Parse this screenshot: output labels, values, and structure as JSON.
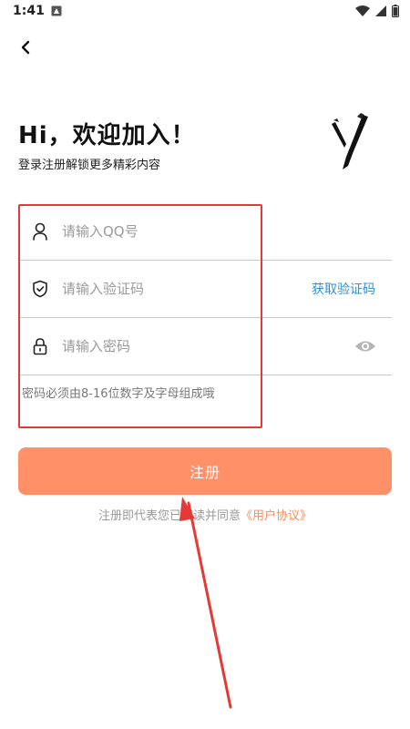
{
  "status_bar": {
    "time": "1:41",
    "icons": [
      "notification-icon",
      "wifi-icon",
      "signal-icon",
      "battery-icon"
    ]
  },
  "header": {
    "back_icon": "chevron-left-icon"
  },
  "hero": {
    "title": "Hi，欢迎加入！",
    "subtitle": "登录注册解锁更多精彩内容",
    "logo_icon": "brand-y-logo"
  },
  "form": {
    "qq": {
      "placeholder": "请输入QQ号",
      "value": "",
      "icon": "user-icon"
    },
    "code": {
      "placeholder": "请输入验证码",
      "value": "",
      "icon": "shield-icon",
      "action_label": "获取验证码"
    },
    "password": {
      "placeholder": "请输入密码",
      "value": "",
      "icon": "lock-icon",
      "toggle_icon": "eye-icon"
    },
    "hint": "密码必须由8-16位数字及字母组成哦"
  },
  "register_button": {
    "label": "注册"
  },
  "agreement": {
    "prefix": "注册即代表您已阅读并同意",
    "link": "《用户协议》"
  },
  "colors": {
    "accent": "#ff9068",
    "link_blue": "#2f8fd8",
    "annotation_red": "#e53935"
  }
}
